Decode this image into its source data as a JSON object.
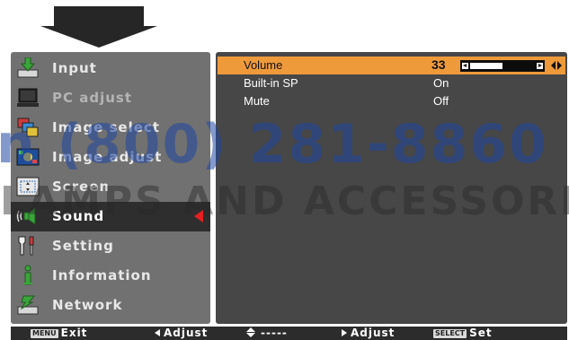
{
  "menu": {
    "items": [
      {
        "label": "Input",
        "icon": "input-icon",
        "state": "normal"
      },
      {
        "label": "PC adjust",
        "icon": "pc-adjust-icon",
        "state": "disabled"
      },
      {
        "label": "Image select",
        "icon": "image-select-icon",
        "state": "normal"
      },
      {
        "label": "Image adjust",
        "icon": "image-adjust-icon",
        "state": "normal"
      },
      {
        "label": "Screen",
        "icon": "screen-icon",
        "state": "normal"
      },
      {
        "label": "Sound",
        "icon": "sound-icon",
        "state": "selected"
      },
      {
        "label": "Setting",
        "icon": "setting-icon",
        "state": "normal"
      },
      {
        "label": "Information",
        "icon": "information-icon",
        "state": "normal"
      },
      {
        "label": "Network",
        "icon": "network-icon",
        "state": "normal"
      }
    ]
  },
  "sound": {
    "rows": [
      {
        "label": "Volume",
        "value": "33",
        "level": 0.5,
        "highlighted": true
      },
      {
        "label": "Built-in SP",
        "value": "On",
        "highlighted": false
      },
      {
        "label": "Mute",
        "value": "Off",
        "highlighted": false
      }
    ]
  },
  "footer": {
    "exit_tag": "MENU",
    "exit": "Exit",
    "adjust_left": "Adjust",
    "updown": "-----",
    "adjust_right": "Adjust",
    "set_tag": "SELECT",
    "set": "Set"
  },
  "watermark": {
    "phone": "n (800) 281-8860",
    "company": "LAMPS AND ACCESSORIES"
  },
  "colors": {
    "highlight": "#ef9a3a",
    "menu_bg": "#717171",
    "panel_bg": "#474747",
    "selection_marker": "#e52020"
  }
}
